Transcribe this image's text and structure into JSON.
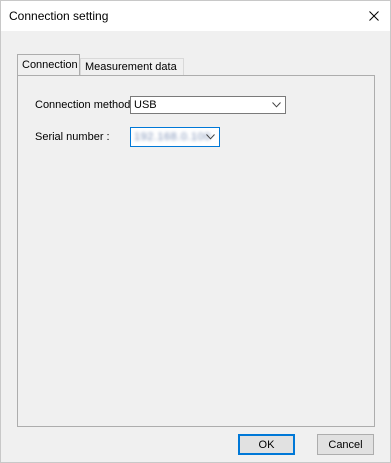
{
  "window": {
    "title": "Connection setting",
    "close_icon": "close-icon"
  },
  "tabs": [
    {
      "label": "Connection",
      "active": true
    },
    {
      "label": "Measurement data",
      "active": false
    }
  ],
  "connection": {
    "method_label": "Connection method :",
    "method_value": "USB",
    "serial_label": "Serial number :",
    "serial_value": "192.168.0.100"
  },
  "buttons": {
    "ok": "OK",
    "cancel": "Cancel"
  },
  "colors": {
    "focus_accent": "#0078d7",
    "button_face": "#e1e1e1",
    "window_bg": "#f0f0f0"
  }
}
